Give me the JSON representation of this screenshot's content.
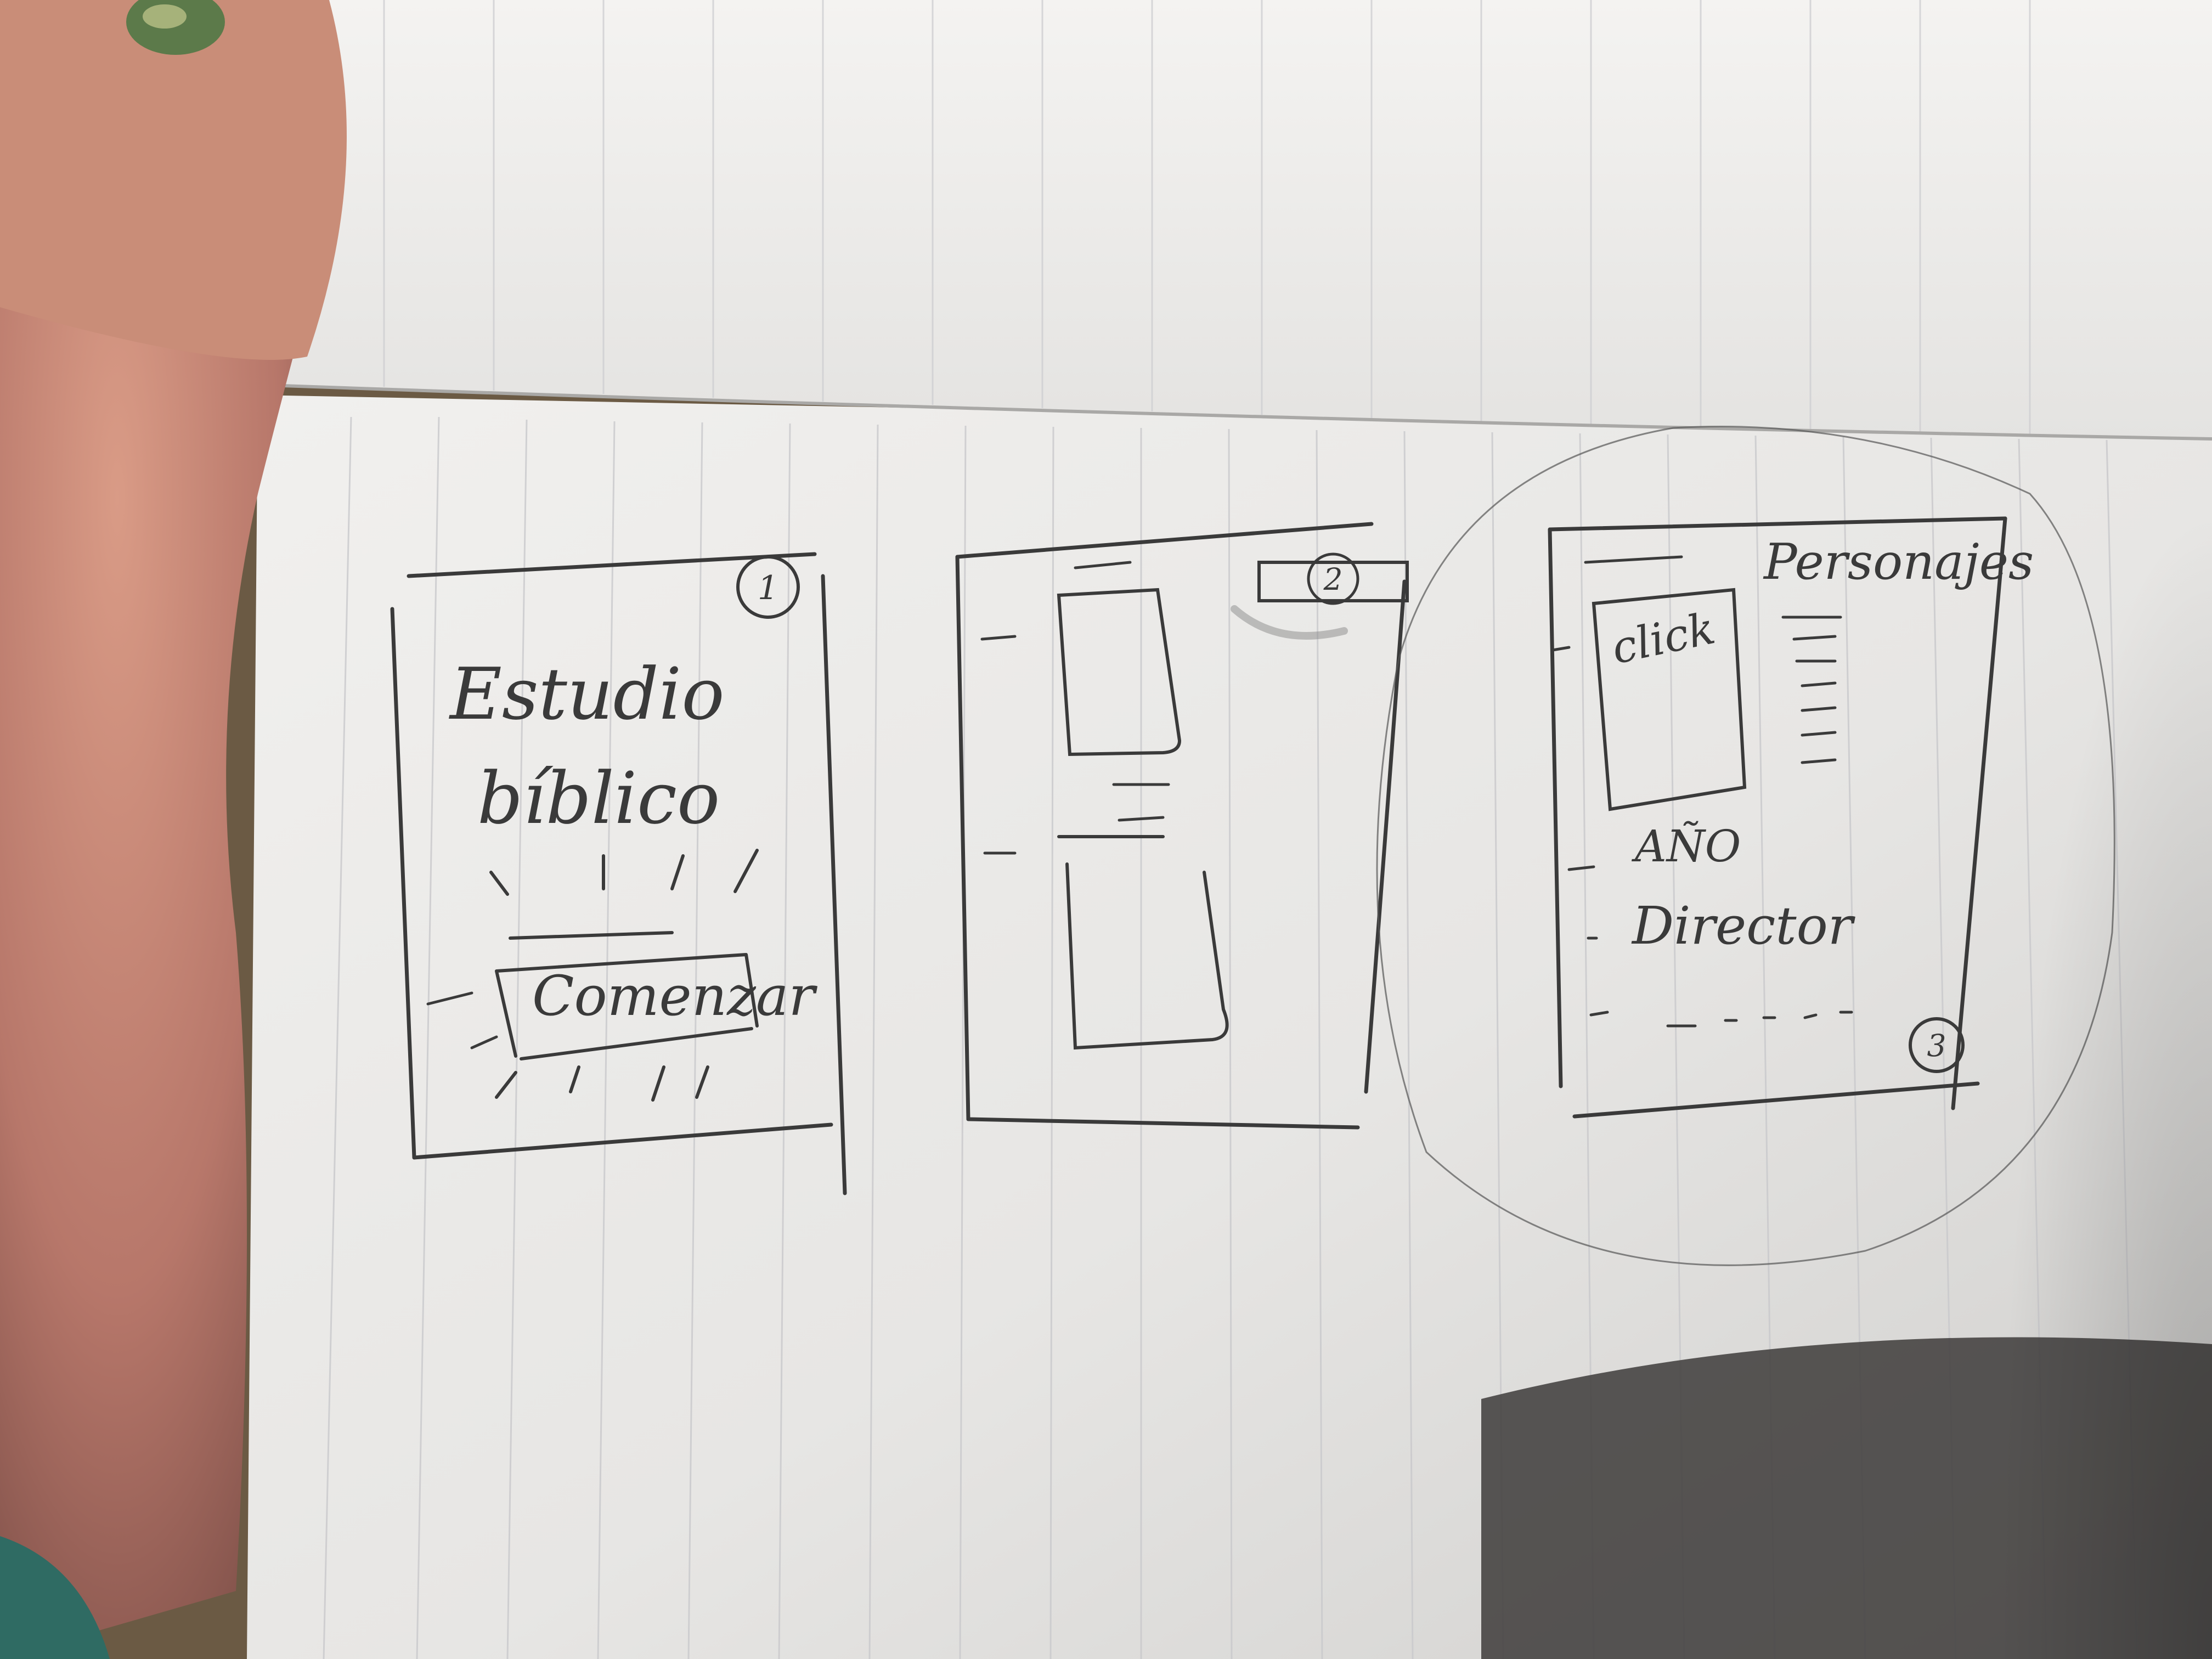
{
  "frame1": {
    "number": "1",
    "title_line1": "Estudio",
    "title_line2": "bíblico",
    "button_label": "Comenzar"
  },
  "frame2": {
    "number": "2"
  },
  "frame3": {
    "number": "3",
    "header": "Personajes",
    "image_label": "click",
    "field_year": "AÑO",
    "field_director": "Director"
  },
  "colors": {
    "paper": "#ecebe9",
    "pencil": "#3a3a3a",
    "rule": "#c9c9cc"
  }
}
